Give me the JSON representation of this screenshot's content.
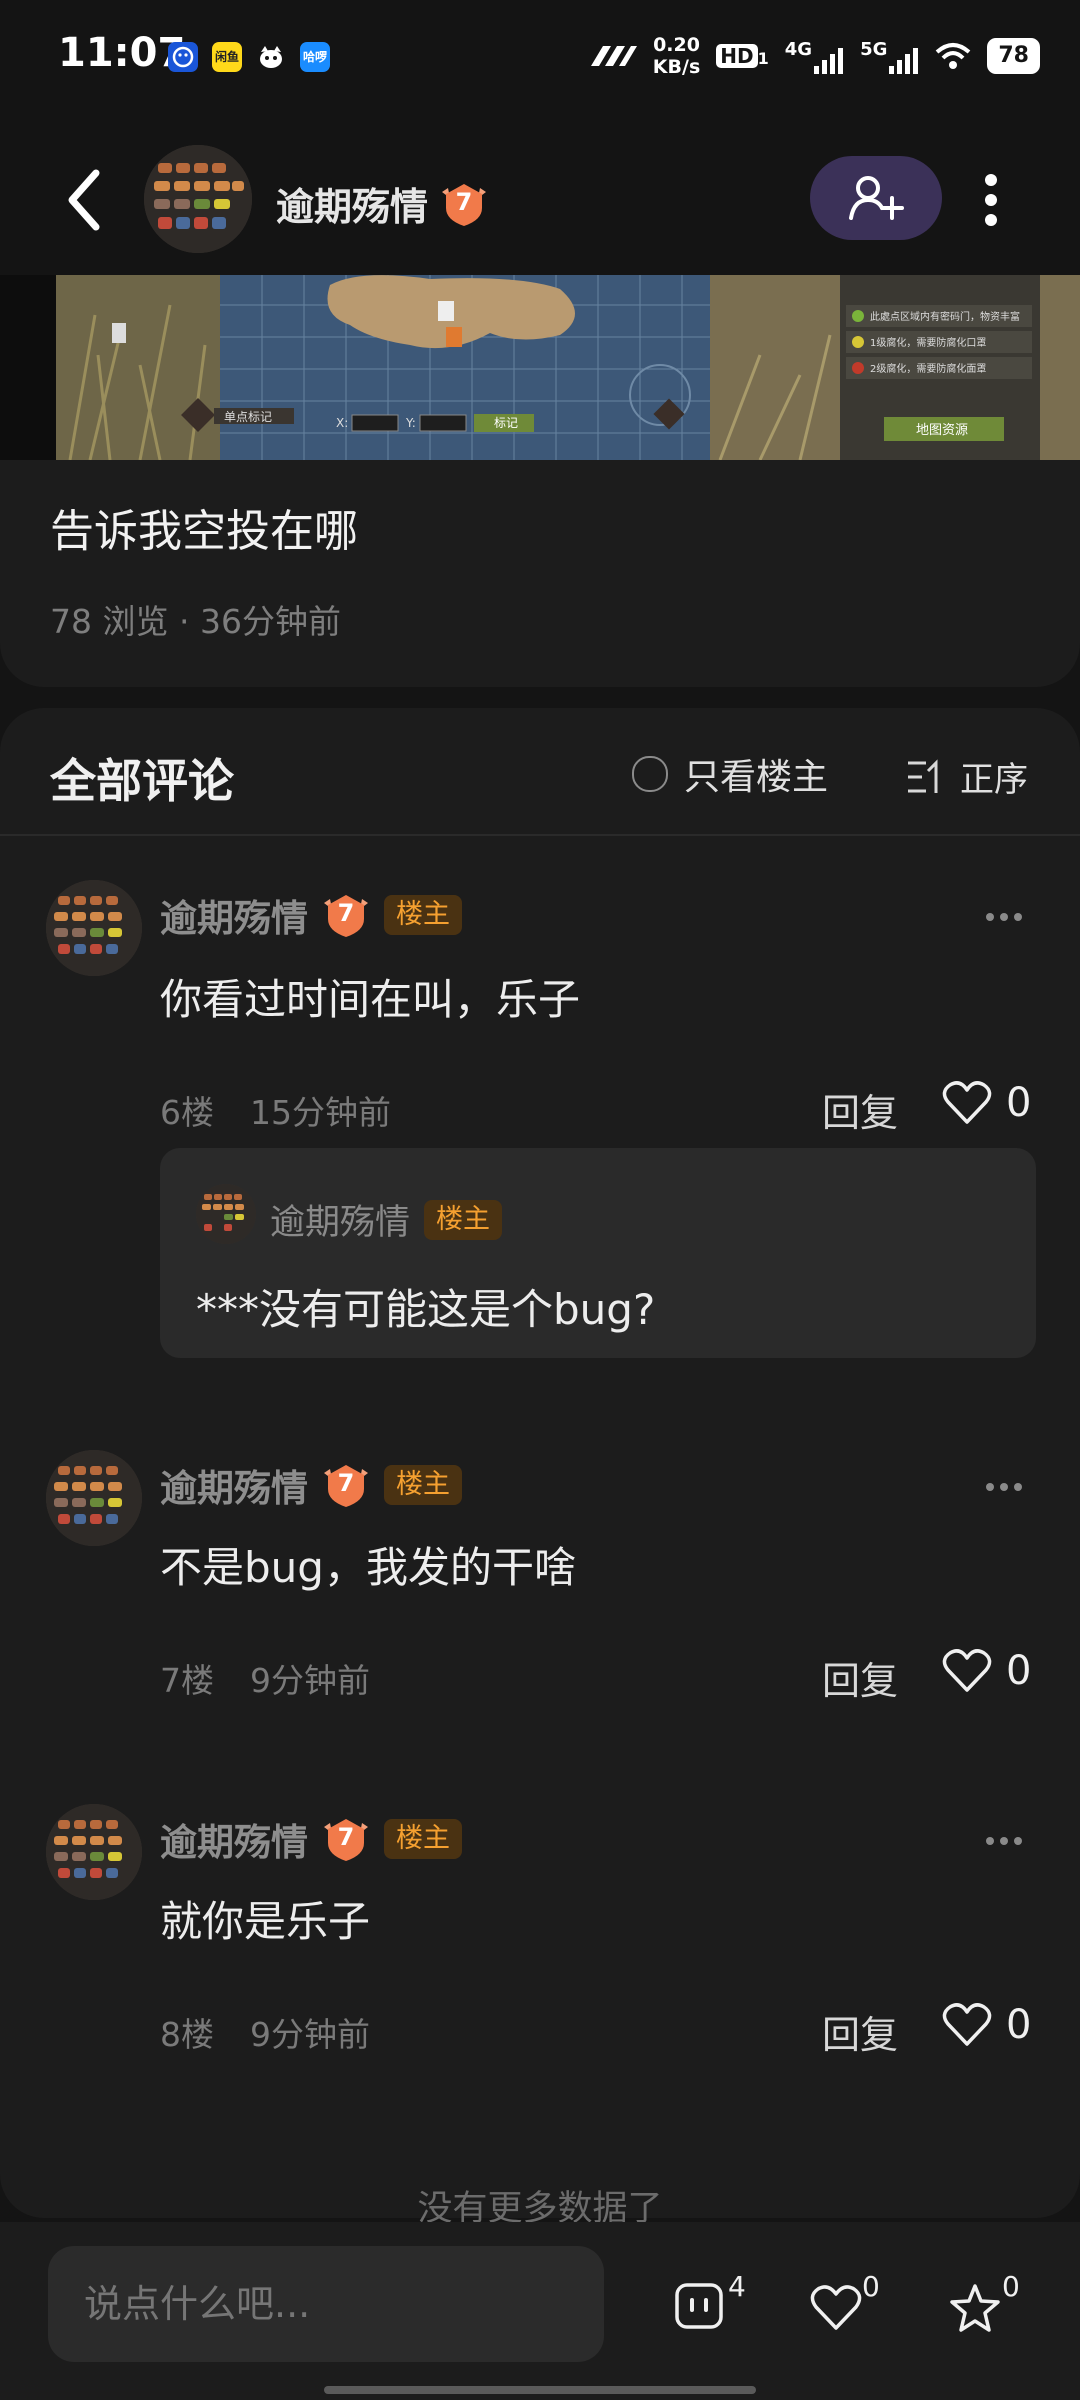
{
  "status_bar": {
    "time": "11:07",
    "net_speed_value": "0.20",
    "net_speed_unit": "KB/s",
    "hd_label": "HD",
    "hd_sub": "1",
    "net_4g": "4G",
    "net_5g": "5G",
    "battery": "78",
    "app_icons": [
      "face-app-icon",
      "yellow-app-icon",
      "cat-app-icon",
      "blue-app-icon"
    ],
    "yellow_app_text": "闲鱼",
    "blue_app_text": "哈啰"
  },
  "header": {
    "username": "逾期殇情",
    "level": "7"
  },
  "post": {
    "title": "告诉我空投在哪",
    "meta": "78 浏览 · 36分钟前",
    "banner_texts": {
      "mark_button": "单点标记",
      "x_label": "X:",
      "y_label": "Y:",
      "mark_confirm": "标记",
      "legend_1": "此處点区域内有密码门，物资丰富",
      "legend_2": "1级腐化，需要防腐化口罩",
      "legend_3": "2级腐化，需要防腐化面罩",
      "map_resource": "地图资源"
    }
  },
  "comments": {
    "title": "全部评论",
    "op_only_label": "只看楼主",
    "sort_label": "正序",
    "items": [
      {
        "author": "逾期殇情",
        "level": "7",
        "tag": "楼主",
        "text": "你看过时间在叫，乐子",
        "floor": "6楼",
        "time": "15分钟前",
        "reply": "回复",
        "likes": "0"
      },
      {
        "author": "逾期殇情",
        "level": "7",
        "tag": "楼主",
        "text": "不是bug，我发的干啥",
        "floor": "7楼",
        "time": "9分钟前",
        "reply": "回复",
        "likes": "0"
      },
      {
        "author": "逾期殇情",
        "level": "7",
        "tag": "楼主",
        "text": "就你是乐子",
        "floor": "8楼",
        "time": "9分钟前",
        "reply": "回复",
        "likes": "0"
      }
    ],
    "quote": {
      "author": "逾期殇情",
      "tag": "楼主",
      "text": "***没有可能这是个bug?"
    },
    "no_more": "没有更多数据了"
  },
  "bottom_bar": {
    "input_placeholder": "说点什么吧...",
    "comment_count": "4",
    "like_count": "0",
    "star_count": "0"
  },
  "colors": {
    "background": "#141414",
    "card": "#1c1c1c",
    "accent_tag": "#f5a030",
    "follow_button": "#3b3158"
  }
}
